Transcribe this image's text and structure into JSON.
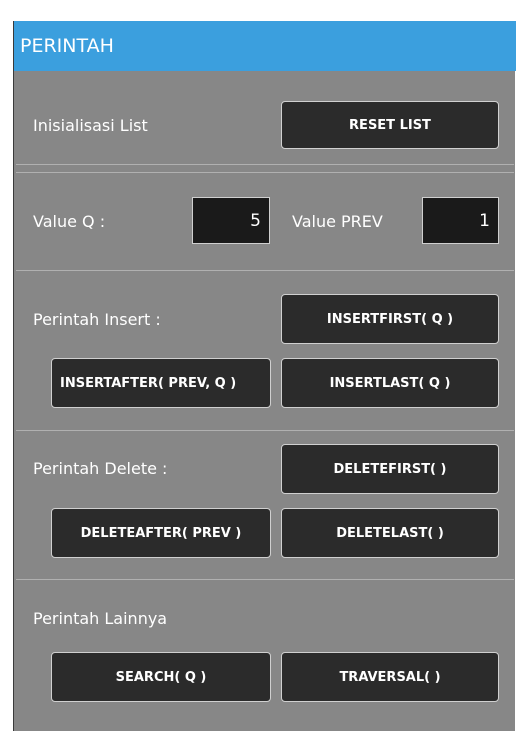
{
  "header": {
    "title": "PERINTAH"
  },
  "init": {
    "label": "Inisialisasi List",
    "reset_button": "RESET LIST"
  },
  "values": {
    "q_label": "Value Q :",
    "q_value": "5",
    "prev_label": "Value PREV",
    "prev_value": "1"
  },
  "insert": {
    "label": "Perintah Insert :",
    "insert_first": "INSERTFIRST( Q )",
    "insert_after": "INSERTAFTER( PREV, Q )",
    "insert_last": "INSERTLAST( Q )"
  },
  "delete": {
    "label": "Perintah Delete :",
    "delete_first": "DELETEFIRST( )",
    "delete_after": "DELETEAFTER( PREV )",
    "delete_last": "DELETELAST( )"
  },
  "other": {
    "label": "Perintah Lainnya",
    "search": "SEARCH( Q )",
    "traversal": "TRAVERSAL( )"
  }
}
